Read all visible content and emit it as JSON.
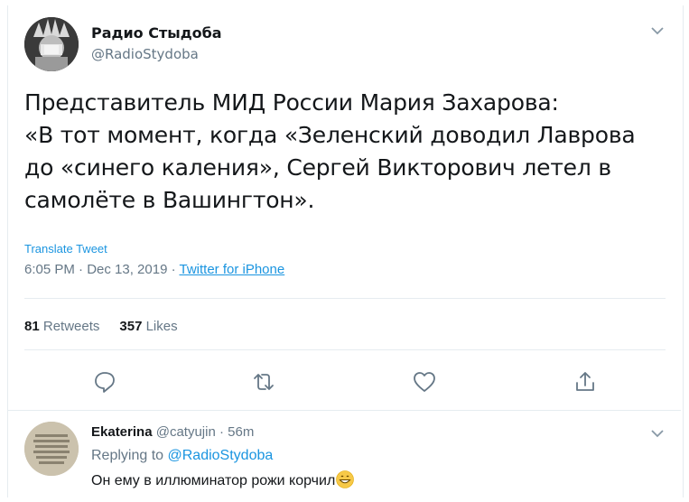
{
  "tweet": {
    "display_name": "Радио Стыдоба",
    "handle": "@RadioStydoba",
    "text": "Представитель МИД России Мария Захарова:\n«В тот момент, когда «Зеленский доводил Лаврова\nдо «синего каления», Сергей Викторович летел в\nсамолёте в Вашингтон».",
    "translate_label": "Translate Tweet",
    "time": "6:05 PM · Dec 13, 2019 · ",
    "source": "Twitter for iPhone",
    "retweets_count": "81",
    "retweets_label": "Retweets",
    "likes_count": "357",
    "likes_label": "Likes"
  },
  "actions": {
    "reply_icon": "reply-icon",
    "retweet_icon": "retweet-icon",
    "like_icon": "heart-icon",
    "share_icon": "share-icon"
  },
  "reply": {
    "display_name": "Ekaterina",
    "handle": "@catyujin",
    "dot": "·",
    "time": "56m",
    "replying_prefix": "Replying to",
    "replying_to": "@RadioStydoba",
    "text": "Он ему в иллюминатор рожи корчил",
    "emoji": "grinning-face-emoji"
  },
  "colors": {
    "link": "#1b95e0",
    "muted": "#657786",
    "text": "#14171a",
    "border": "#e6ecf0"
  }
}
